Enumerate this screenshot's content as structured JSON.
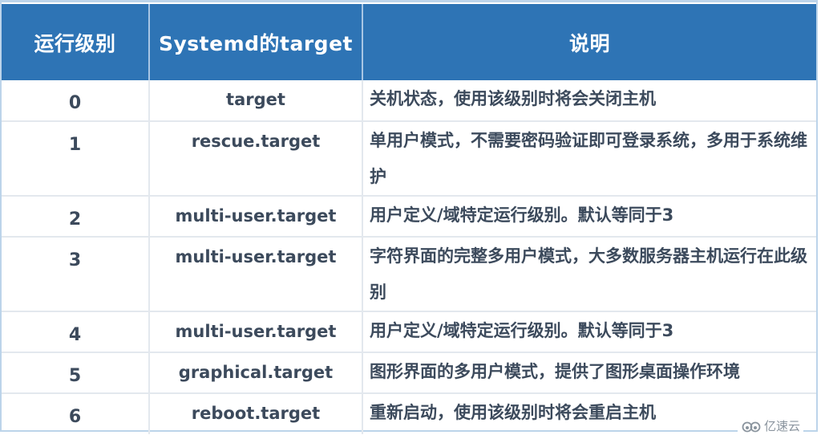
{
  "table": {
    "headers": [
      "运行级别",
      "Systemd的target",
      "说明"
    ],
    "rows": [
      {
        "level": "0",
        "target": "target",
        "description": "关机状态，使用该级别时将会关闭主机"
      },
      {
        "level": "1",
        "target": "rescue.target",
        "description": "单用户模式，不需要密码验证即可登录系统，多用于系统维护"
      },
      {
        "level": "2",
        "target": "multi-user.target",
        "description": "用户定义/域特定运行级别。默认等同于3"
      },
      {
        "level": "3",
        "target": "multi-user.target",
        "description": "字符界面的完整多用户模式，大多数服务器主机运行在此级别"
      },
      {
        "level": "4",
        "target": "multi-user.target",
        "description": "用户定义/域特定运行级别。默认等同于3"
      },
      {
        "level": "5",
        "target": "graphical.target",
        "description": "图形界面的多用户模式，提供了图形桌面操作环境"
      },
      {
        "level": "6",
        "target": "reboot.target",
        "description": "重新启动，使用该级别时将会重启主机"
      }
    ]
  },
  "watermark": {
    "icon": "cloud-logo-icon",
    "text": "亿速云"
  },
  "colors": {
    "header_bg": "#2e74b5",
    "header_text": "#ffffff",
    "body_text": "#3c4a5c",
    "grid_line": "#e3e8ee",
    "frame_border": "#bcd4ea"
  }
}
